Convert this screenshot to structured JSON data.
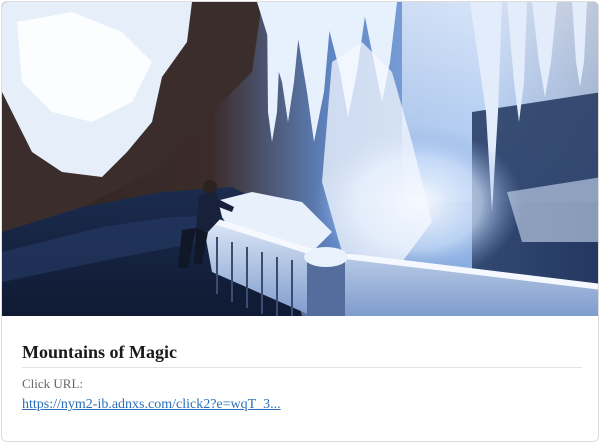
{
  "card": {
    "title": "Mountains of Magic",
    "click_url_label": "Click URL:",
    "click_url": "https://nym2-ib.adnxs.com/click2?e=wqT_3...",
    "link_color": "#2a6fb8"
  },
  "image": {
    "subject": "frozen waterfall with icicles and a person on a railed walkway"
  }
}
